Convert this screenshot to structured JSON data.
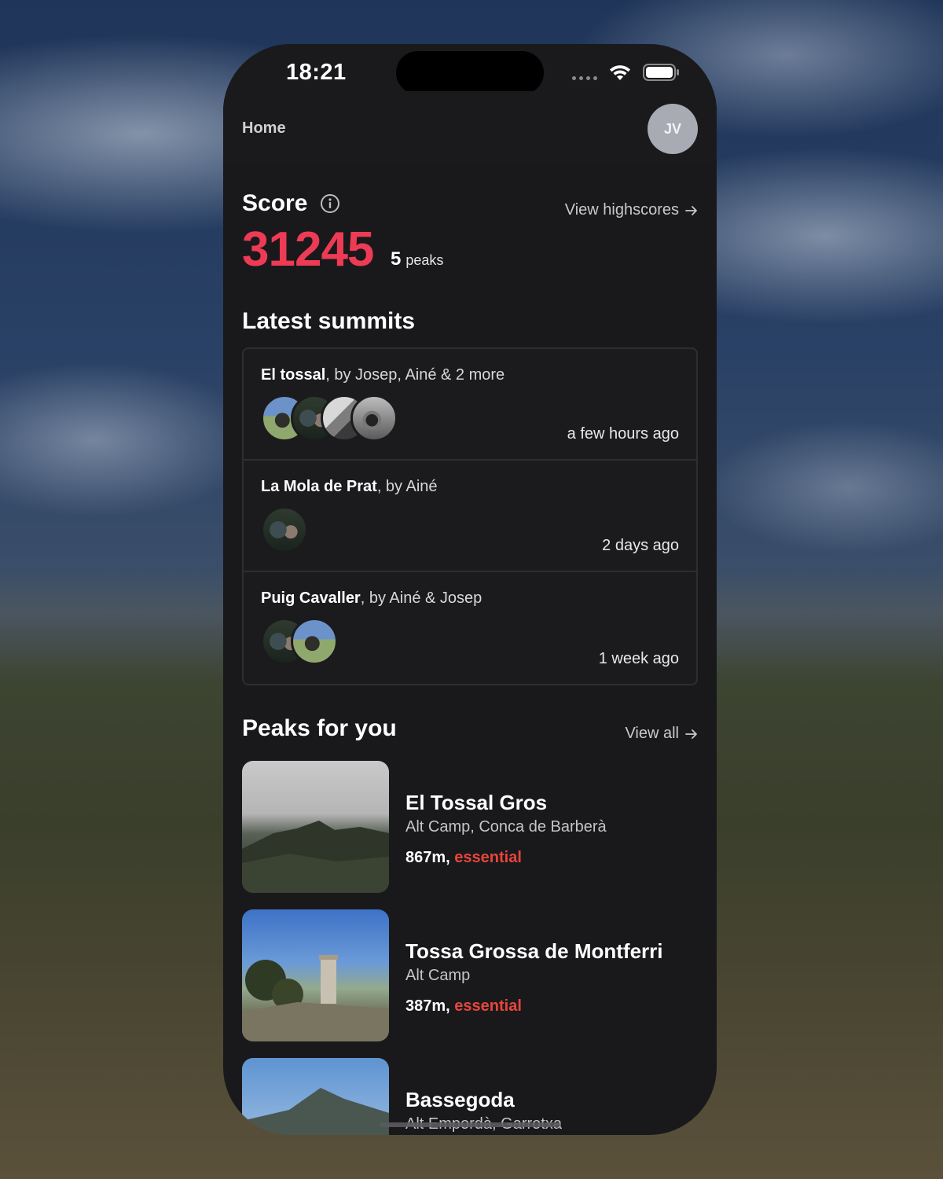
{
  "status_bar": {
    "time": "18:21"
  },
  "header": {
    "title": "Home",
    "avatar_initials": "JV"
  },
  "score": {
    "title": "Score",
    "value": "31245",
    "peaks_count": "5",
    "peaks_unit": "peaks",
    "view_highscores_label": "View highscores"
  },
  "latest_summits": {
    "title": "Latest summits",
    "items": [
      {
        "peak": "El tossal",
        "by_text": ", by Josep, Ainé & 2 more",
        "time": "a few hours ago"
      },
      {
        "peak": "La Mola de Prat",
        "by_text": ", by Ainé",
        "time": "2 days ago"
      },
      {
        "peak": "Puig Cavaller",
        "by_text": ", by Ainé & Josep",
        "time": "1 week ago"
      }
    ]
  },
  "peaks_for_you": {
    "title": "Peaks for you",
    "view_all_label": "View all",
    "items": [
      {
        "name": "El Tossal Gros",
        "region": "Alt Camp, Conca de Barberà",
        "height": "867m",
        "tag": "essential"
      },
      {
        "name": "Tossa Grossa de Montferri",
        "region": "Alt Camp",
        "height": "387m",
        "tag": "essential"
      },
      {
        "name": "Bassegoda",
        "region": "Alt Empordà, Garrotxa"
      }
    ]
  },
  "colors": {
    "score_accent": "#ee3b55",
    "essential_tag": "#e8453c",
    "background": "#19191b"
  },
  "icons": [
    "info-icon",
    "arrow-right-icon",
    "wifi-icon",
    "battery-icon",
    "cellular-dots-icon"
  ]
}
